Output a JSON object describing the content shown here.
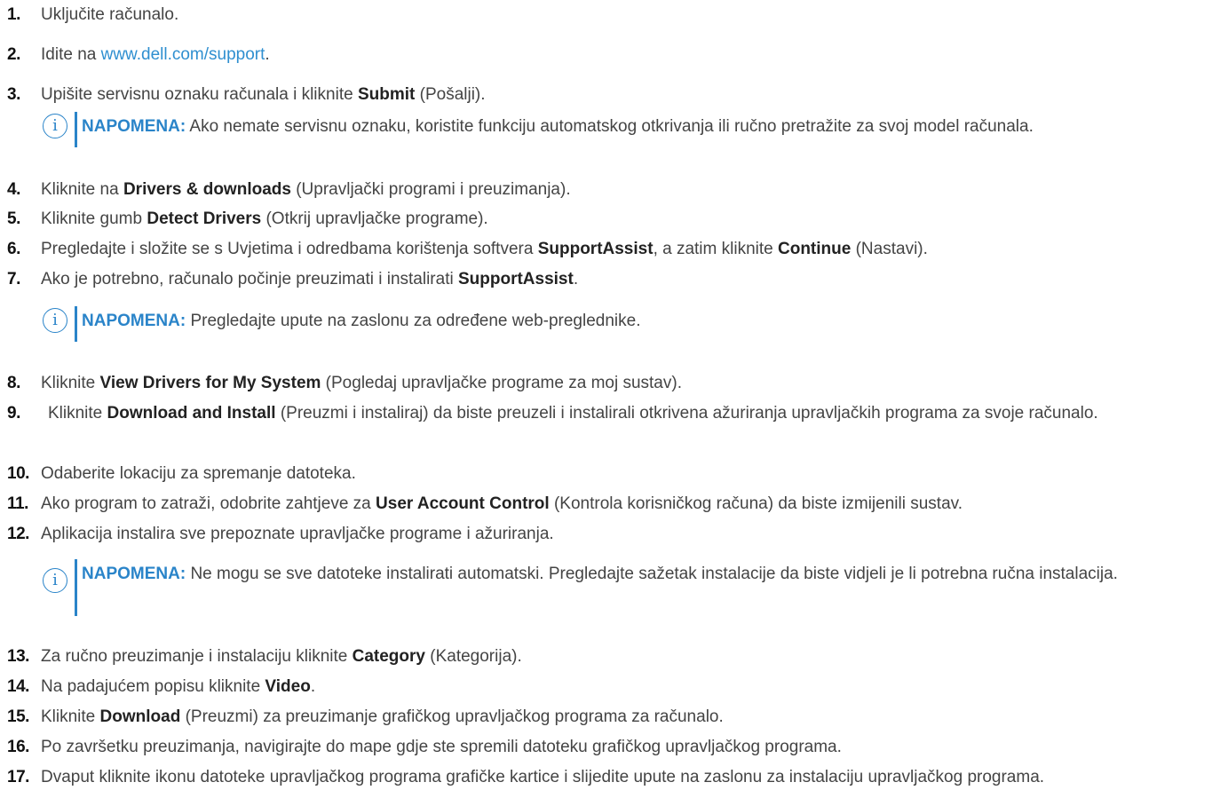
{
  "link_color": "#2f8fd0",
  "accent_color": "#2a84c9",
  "steps": [
    {
      "num": "1.",
      "parts": [
        {
          "t": "Uključite računalo."
        }
      ]
    },
    {
      "num": "2.",
      "parts": [
        {
          "t": "Idite na "
        },
        {
          "t": "www.dell.com/support",
          "link": true
        },
        {
          "t": "."
        }
      ]
    },
    {
      "num": "3.",
      "parts": [
        {
          "t": "Upišite servisnu oznaku računala i kliknite "
        },
        {
          "t": "Submit",
          "b": true
        },
        {
          "t": " (Pošalji)."
        }
      ]
    },
    {
      "num": "4.",
      "parts": [
        {
          "t": "Kliknite na "
        },
        {
          "t": "Drivers & downloads",
          "b": true
        },
        {
          "t": " (Upravljački programi i preuzimanja)."
        }
      ]
    },
    {
      "num": "5.",
      "parts": [
        {
          "t": "Kliknite gumb "
        },
        {
          "t": "Detect Drivers",
          "b": true
        },
        {
          "t": " (Otkrij upravljačke programe)."
        }
      ]
    },
    {
      "num": "6.",
      "parts": [
        {
          "t": "Pregledajte i složite se s Uvjetima i odredbama korištenja softvera "
        },
        {
          "t": "SupportAssist",
          "b": true
        },
        {
          "t": ", a zatim kliknite "
        },
        {
          "t": "Continue",
          "b": true
        },
        {
          "t": " (Nastavi)."
        }
      ]
    },
    {
      "num": "7.",
      "parts": [
        {
          "t": "Ako je potrebno, računalo počinje preuzimati i instalirati "
        },
        {
          "t": "SupportAssist",
          "b": true
        },
        {
          "t": "."
        }
      ]
    },
    {
      "num": "8.",
      "parts": [
        {
          "t": "Kliknite "
        },
        {
          "t": "View Drivers for My System",
          "b": true
        },
        {
          "t": " (Pogledaj upravljačke programe za moj sustav)."
        }
      ]
    },
    {
      "num": "9.",
      "parts": [
        {
          "t": "Kliknite "
        },
        {
          "t": "Download and Install",
          "b": true
        },
        {
          "t": " (Preuzmi i instaliraj) da biste preuzeli i instalirali otkrivena ažuriranja upravljačkih programa za svoje računalo."
        }
      ]
    },
    {
      "num": "10.",
      "parts": [
        {
          "t": "Odaberite lokaciju za spremanje datoteka."
        }
      ]
    },
    {
      "num": "11.",
      "parts": [
        {
          "t": "Ako program to zatraži, odobrite zahtjeve za "
        },
        {
          "t": "User Account Control",
          "b": true
        },
        {
          "t": " (Kontrola korisničkog računa) da biste izmijenili sustav."
        }
      ]
    },
    {
      "num": "12.",
      "parts": [
        {
          "t": "Aplikacija instalira sve prepoznate upravljačke programe i ažuriranja."
        }
      ]
    },
    {
      "num": "13.",
      "parts": [
        {
          "t": "Za ručno preuzimanje i instalaciju kliknite "
        },
        {
          "t": "Category",
          "b": true
        },
        {
          "t": " (Kategorija)."
        }
      ]
    },
    {
      "num": "14.",
      "parts": [
        {
          "t": "Na padajućem popisu kliknite "
        },
        {
          "t": "Video",
          "b": true
        },
        {
          "t": "."
        }
      ]
    },
    {
      "num": "15.",
      "parts": [
        {
          "t": "Kliknite "
        },
        {
          "t": "Download",
          "b": true
        },
        {
          "t": " (Preuzmi) za preuzimanje grafičkog upravljačkog programa za računalo."
        }
      ]
    },
    {
      "num": "16.",
      "parts": [
        {
          "t": "Po završetku preuzimanja, navigirajte do mape gdje ste spremili datoteku grafičkog upravljačkog programa."
        }
      ]
    },
    {
      "num": "17.",
      "parts": [
        {
          "t": "Dvaput kliknite ikonu datoteke upravljačkog programa grafičke kartice i slijedite upute na zaslonu za instalaciju upravljačkog programa."
        }
      ]
    }
  ],
  "notes": [
    {
      "label": "NAPOMENA:",
      "text": " Ako nemate servisnu oznaku, koristite funkciju automatskog otkrivanja ili ručno pretražite za svoj model računala."
    },
    {
      "label": "NAPOMENA:",
      "text": " Pregledajte upute na zaslonu za određene web-preglednike."
    },
    {
      "label": "NAPOMENA:",
      "text": " Ne mogu se sve datoteke instalirati automatski. Pregledajte sažetak instalacije da biste vidjeli je li potrebna ručna instalacija."
    }
  ],
  "note_icon_glyph": "i"
}
